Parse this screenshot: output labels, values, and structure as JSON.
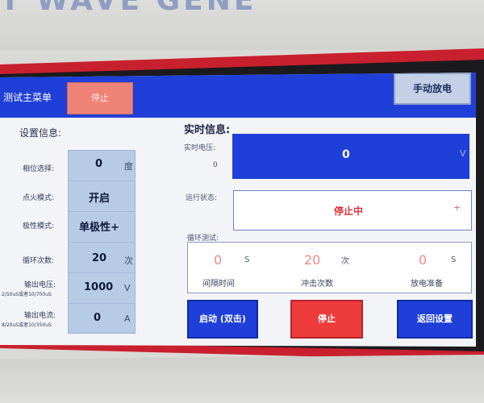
{
  "casing": {
    "label": "T WAVE GENE"
  },
  "header": {
    "main_menu": "测试主菜单",
    "stop_button": "停止",
    "discharge_button": "手动放电"
  },
  "settings": {
    "title": "设置信息:",
    "rows": [
      {
        "label": "相位选择:",
        "sub": "",
        "value": "0",
        "unit": "度"
      },
      {
        "label": "点火模式:",
        "sub": "",
        "value": "开启",
        "unit": ""
      },
      {
        "label": "极性模式:",
        "sub": "",
        "value": "单极性+",
        "unit": ""
      },
      {
        "label": "循环次数:",
        "sub": "",
        "value": "20",
        "unit": "次"
      },
      {
        "label": "输出电压:",
        "sub": "2/50uS或者10/700uS",
        "value": "1000",
        "unit": "V"
      },
      {
        "label": "输出电流:",
        "sub": "8/20uS或者10/350uS",
        "value": "0",
        "unit": "A"
      }
    ]
  },
  "realtime": {
    "title": "实时信息:",
    "voltage_label": "实时电压:",
    "voltage_side": "0",
    "voltage_value": "0",
    "voltage_unit": "V",
    "status_label": "运行状态:",
    "status_value": "停止中",
    "status_mark": "+",
    "cycle_label": "循环测试:",
    "cycle": [
      {
        "value": "0",
        "unit": "S",
        "caption": "间隔时间"
      },
      {
        "value": "20",
        "unit": "次",
        "caption": "冲击次数"
      },
      {
        "value": "0",
        "unit": "S",
        "caption": "放电准备"
      }
    ]
  },
  "buttons": {
    "start": "启动 (双击)",
    "stop": "停止",
    "back": "返回设置"
  },
  "colors": {
    "header_blue": "#1f3fd8",
    "frame_red": "#c8202e",
    "stop_red": "#ee3b3b",
    "status_red": "#e0313a",
    "panel_blue": "#b8cbe6"
  }
}
